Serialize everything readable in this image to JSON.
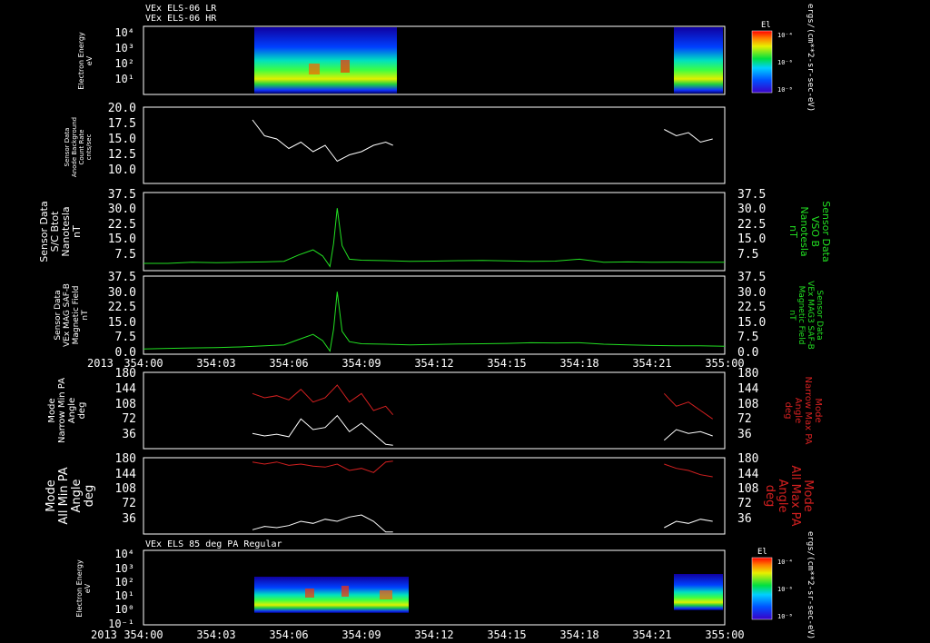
{
  "header": {
    "line1": "VEx ELS-06 LR",
    "line2": "VEx ELS-06 HR",
    "bottom_panel_title": "VEx ELS 85 deg PA Regular"
  },
  "x_axis": {
    "year_label": "2013",
    "ticks": [
      "354:00",
      "354:03",
      "354:06",
      "354:09",
      "354:12",
      "354:15",
      "354:18",
      "354:21",
      "355:00"
    ],
    "range_min": [
      0,
      24
    ]
  },
  "colorbar": {
    "label": "El",
    "ticks": [
      "10⁻⁴",
      "10⁻⁶",
      "10⁻⁸"
    ],
    "units": "ergs/(cm**2-sr-sec-eV)"
  },
  "colors": {
    "background": "#000000",
    "trace_white": "#ffffff",
    "trace_green": "#22e022",
    "trace_red": "#d42020"
  },
  "panels": {
    "p1": {
      "ylabel": [
        "Electron Energy",
        "eV"
      ],
      "ticks": [
        "10⁴",
        "10³",
        "10²",
        "10¹"
      ]
    },
    "p2": {
      "ylabel": [
        "Sensor Data",
        "Anode Background",
        "Count Rate",
        "cnts/sec"
      ],
      "ticks": [
        "20.0",
        "17.5",
        "15.0",
        "12.5",
        "10.0"
      ]
    },
    "p3": {
      "ylabel": [
        "Sensor Data",
        "S/C Btot",
        "Nanotesla",
        "nT"
      ],
      "rlabel": [
        "Sensor Data",
        "VSO B",
        "Nanotesla",
        "nT"
      ],
      "ticks": [
        "37.5",
        "30.0",
        "22.5",
        "15.0",
        "7.5"
      ]
    },
    "p4": {
      "ylabel": [
        "Sensor Data",
        "VEx MAG SAF-B",
        "Magnetic Field",
        "nT"
      ],
      "rlabel": [
        "Sensor Data",
        "VEx MAG3 SAF-B",
        "Magnetic Field",
        "nT"
      ],
      "ticks": [
        "37.5",
        "30.0",
        "22.5",
        "15.0",
        "7.5",
        "0.0"
      ]
    },
    "p5": {
      "ylabel": [
        "Mode",
        "Narrow Min PA",
        "Angle",
        "deg"
      ],
      "rlabel": [
        "Mode",
        "Narrow Max PA",
        "Angle",
        "deg"
      ],
      "ticks": [
        "180",
        "144",
        "108",
        "72",
        "36"
      ]
    },
    "p6": {
      "ylabel": [
        "Mode",
        "All Min PA",
        "Angle",
        "deg"
      ],
      "rlabel": [
        "Mode",
        "All Max PA",
        "Angle",
        "deg"
      ],
      "ticks": [
        "180",
        "144",
        "108",
        "72",
        "36"
      ]
    },
    "p7": {
      "ylabel": [
        "Electron Energy",
        "eV"
      ],
      "ticks": [
        "10⁴",
        "10³",
        "10²",
        "10¹",
        "10⁰",
        "10⁻¹"
      ]
    }
  },
  "chart_data": [
    {
      "type": "heatmap",
      "title": "VEx ELS-06 LR / VEx ELS-06 HR",
      "ylabel": "Electron Energy eV",
      "y_scale": "log",
      "ylim": [
        1,
        10000
      ],
      "data_intervals_min": [
        [
          4.5,
          10.3
        ],
        [
          21.5,
          23.6
        ]
      ]
    },
    {
      "type": "line",
      "ylabel": "Sensor Data Anode Background Count Rate cnts/sec",
      "ylim": [
        8.0,
        20.0
      ],
      "x_min": [
        4.5,
        5.0,
        5.5,
        6.0,
        6.5,
        7.0,
        7.5,
        8.0,
        8.5,
        9.0,
        9.5,
        10.0,
        10.3,
        21.5,
        22.0,
        22.5,
        23.0,
        23.5
      ],
      "y": [
        18.0,
        15.5,
        15.0,
        13.5,
        14.5,
        13.0,
        14.0,
        11.5,
        12.5,
        13.0,
        14.0,
        14.5,
        14.0,
        16.5,
        15.5,
        16.0,
        14.5,
        15.0
      ]
    },
    {
      "type": "line",
      "ylabel": "Sensor Data S/C Btot Nanotesla nT",
      "ylim": [
        0,
        37.5
      ],
      "x_min": [
        0,
        1,
        2,
        3,
        4,
        5,
        5.8,
        6.4,
        7.0,
        7.4,
        7.7,
        7.85,
        8.0,
        8.2,
        8.5,
        9,
        10,
        11,
        12,
        13,
        14,
        15,
        16,
        17,
        18,
        19,
        20,
        21,
        22,
        23,
        24
      ],
      "y": [
        3.5,
        3.5,
        4.0,
        3.8,
        4.0,
        4.2,
        4.5,
        7.5,
        10.0,
        7.0,
        2.0,
        13.0,
        30.0,
        12.0,
        5.5,
        5.0,
        4.8,
        4.5,
        4.6,
        4.8,
        4.9,
        4.7,
        4.5,
        4.6,
        5.5,
        4.0,
        4.2,
        4.0,
        4.1,
        4.0,
        4.0
      ]
    },
    {
      "type": "line",
      "ylabel": "Sensor Data VEx MAG SAF-B Magnetic Field nT",
      "ylim": [
        0,
        37.5
      ],
      "x_min": [
        0,
        1,
        2,
        3,
        4,
        5,
        5.8,
        6.4,
        7.0,
        7.4,
        7.7,
        7.85,
        8.0,
        8.2,
        8.5,
        9,
        10,
        11,
        12,
        13,
        14,
        15,
        16,
        17,
        18,
        19,
        20,
        21,
        22,
        23,
        24
      ],
      "y": [
        2.5,
        2.8,
        3.0,
        3.2,
        3.5,
        4.0,
        4.5,
        7.0,
        9.5,
        6.5,
        1.5,
        12.0,
        30.0,
        11.0,
        6.0,
        5.0,
        4.8,
        4.5,
        4.7,
        4.9,
        5.0,
        5.2,
        5.5,
        5.4,
        5.5,
        4.8,
        4.5,
        4.2,
        4.0,
        4.0,
        3.8
      ]
    },
    {
      "type": "line",
      "ylabel": "Mode Narrow Min PA Angle deg / Mode Narrow Max PA Angle deg",
      "ylim": [
        0,
        180
      ],
      "series": [
        {
          "name": "Mode Narrow Min PA Angle deg",
          "x_min": [
            4.5,
            5.0,
            5.5,
            6.0,
            6.5,
            7.0,
            7.5,
            8.0,
            8.5,
            9.0,
            9.5,
            10.0,
            10.3,
            21.5,
            22.0,
            22.5,
            23.0,
            23.5
          ],
          "y": [
            36,
            30,
            34,
            28,
            70,
            45,
            50,
            78,
            40,
            60,
            35,
            10,
            8,
            20,
            45,
            36,
            40,
            30
          ]
        },
        {
          "name": "Mode Narrow Max PA Angle deg",
          "x_min": [
            4.5,
            5.0,
            5.5,
            6.0,
            6.5,
            7.0,
            7.5,
            8.0,
            8.5,
            9.0,
            9.5,
            10.0,
            10.3,
            21.5,
            22.0,
            22.5,
            23.0,
            23.5
          ],
          "y": [
            130,
            120,
            125,
            115,
            140,
            110,
            120,
            150,
            110,
            130,
            90,
            100,
            80,
            130,
            100,
            110,
            90,
            70
          ]
        }
      ]
    },
    {
      "type": "line",
      "ylabel": "Mode All Min PA Angle deg / Mode All Max PA Angle deg",
      "ylim": [
        0,
        180
      ],
      "series": [
        {
          "name": "Mode All Min PA Angle deg",
          "x_min": [
            4.5,
            5.0,
            5.5,
            6.0,
            6.5,
            7.0,
            7.5,
            8.0,
            8.5,
            9.0,
            9.5,
            10.0,
            10.3,
            21.5,
            22.0,
            22.5,
            23.0,
            23.5
          ],
          "y": [
            10,
            18,
            15,
            20,
            30,
            25,
            35,
            30,
            40,
            45,
            30,
            5,
            5,
            15,
            30,
            25,
            35,
            30
          ]
        },
        {
          "name": "Mode All Max PA Angle deg",
          "x_min": [
            4.5,
            5.0,
            5.5,
            6.0,
            6.5,
            7.0,
            7.5,
            8.0,
            8.5,
            9.0,
            9.5,
            10.0,
            10.3,
            21.5,
            22.0,
            22.5,
            23.0,
            23.5
          ],
          "y": [
            170,
            165,
            170,
            162,
            165,
            160,
            158,
            165,
            150,
            155,
            145,
            170,
            172,
            165,
            155,
            150,
            140,
            135
          ]
        }
      ]
    },
    {
      "type": "heatmap",
      "title": "VEx ELS 85 deg PA Regular",
      "ylabel": "Electron Energy eV",
      "y_scale": "log",
      "ylim": [
        0.1,
        10000
      ],
      "data_intervals_min": [
        [
          4.5,
          10.6
        ],
        [
          21.5,
          23.6
        ]
      ]
    }
  ]
}
